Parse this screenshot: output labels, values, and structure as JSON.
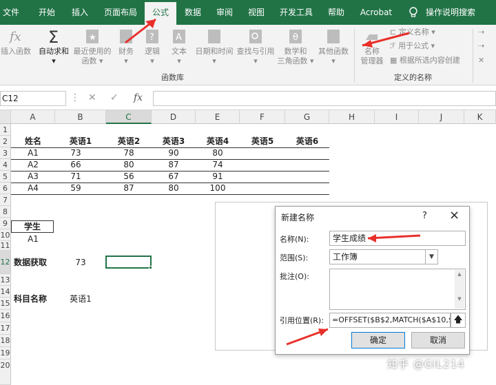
{
  "tabs": [
    {
      "label": "文件"
    },
    {
      "label": "开始"
    },
    {
      "label": "插入"
    },
    {
      "label": "页面布局"
    },
    {
      "label": "公式"
    },
    {
      "label": "数据"
    },
    {
      "label": "审阅"
    },
    {
      "label": "视图"
    },
    {
      "label": "开发工具"
    },
    {
      "label": "帮助"
    },
    {
      "label": "Acrobat"
    },
    {
      "label": "操作说明搜索"
    }
  ],
  "ribbon": {
    "insert_function": "插入函数",
    "autosum": "自动求和",
    "recent_1": "最近使用的",
    "recent_2": "函数",
    "financial": "财务",
    "logical": "逻辑",
    "text": "文本",
    "datetime": "日期和时间",
    "lookup": "查找与引用",
    "math_1": "数学和",
    "math_2": "三角函数",
    "other": "其他函数",
    "group_library": "函数库",
    "name_manager_1": "名称",
    "name_manager_2": "管理器",
    "define_name": "定义名称",
    "use_in_formula": "用于公式",
    "create_from_selection": "根据所选内容创建",
    "group_defined_names": "定义的名称"
  },
  "formula_bar": {
    "namebox": "C12",
    "fx": "fx"
  },
  "columns": [
    "A",
    "B",
    "C",
    "D",
    "E",
    "F",
    "G",
    "H",
    "I",
    "J",
    "K"
  ],
  "rows": [
    "1",
    "2",
    "3",
    "4",
    "5",
    "6",
    "7",
    "8",
    "9",
    "10",
    "11",
    "12",
    "13",
    "14",
    "15",
    "16",
    "17",
    "18",
    "19",
    "20"
  ],
  "sheet": {
    "headers": [
      "姓名",
      "英语1",
      "英语2",
      "英语3",
      "英语4",
      "英语5",
      "英语6"
    ],
    "data": [
      [
        "A1",
        "73",
        "78",
        "90",
        "80"
      ],
      [
        "A2",
        "66",
        "80",
        "87",
        "74"
      ],
      [
        "A3",
        "71",
        "56",
        "67",
        "91"
      ],
      [
        "A4",
        "59",
        "87",
        "80",
        "100"
      ]
    ],
    "student_label": "学生",
    "student_value": "A1",
    "fetch_label": "数据获取",
    "fetch_value": "73",
    "subject_label": "科目名称",
    "subject_value": "英语1"
  },
  "dialog": {
    "title": "新建名称",
    "help": "?",
    "close": "×",
    "name_label": "名称(N):",
    "name_value": "学生成绩",
    "scope_label": "范围(S):",
    "scope_value": "工作簿",
    "comment_label": "批注(O):",
    "ref_label": "引用位置(R):",
    "ref_value": "=OFFSET($B$2,MATCH($A$10,$",
    "ok": "确定",
    "cancel": "取消"
  },
  "watermark": "知乎 @GIL214",
  "colors": {
    "excel_green": "#217346",
    "arrow_red": "#e8302a"
  }
}
